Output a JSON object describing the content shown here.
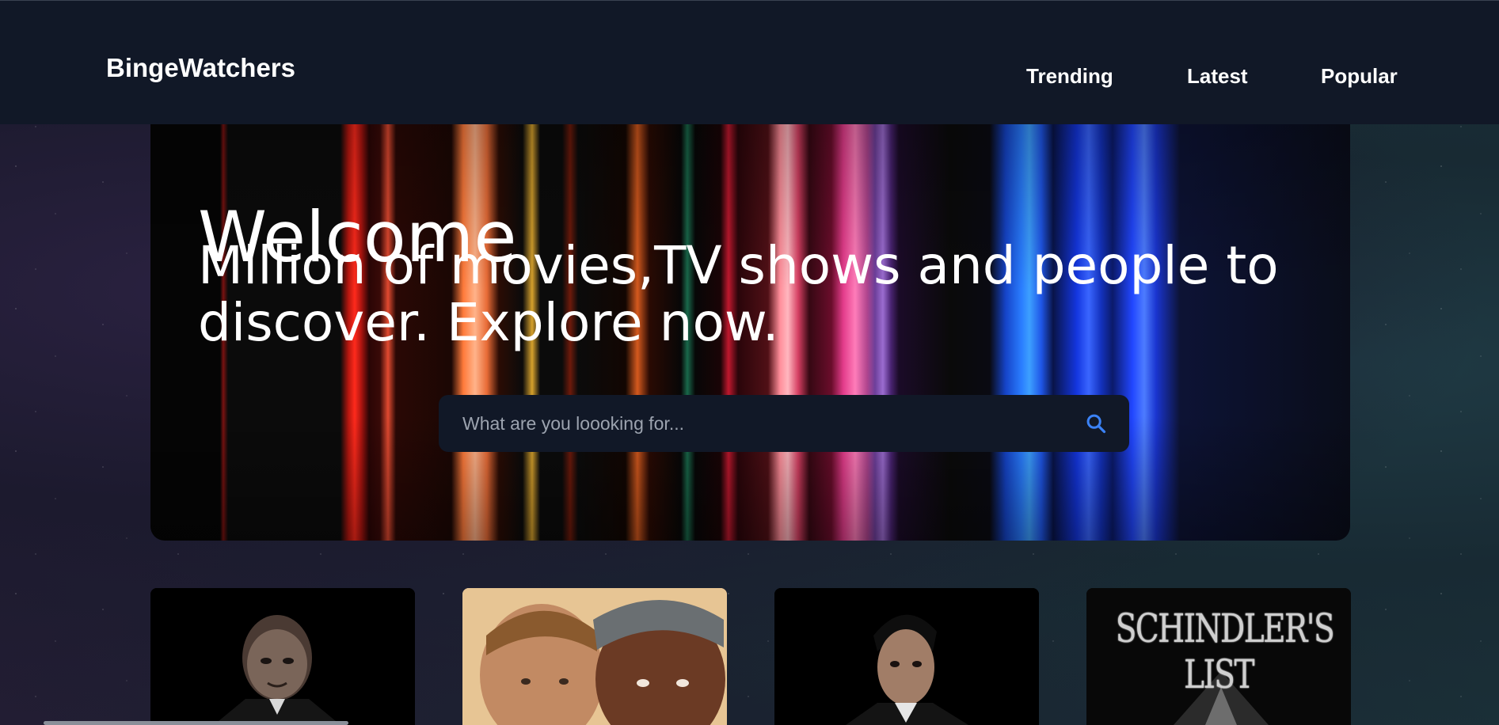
{
  "app": {
    "brand": "BingeWatchers"
  },
  "nav": {
    "items": [
      {
        "label": "Trending"
      },
      {
        "label": "Latest"
      },
      {
        "label": "Popular"
      }
    ]
  },
  "hero": {
    "title": "Welcome",
    "subtitle": "Million of movies,TV shows and people to discover. Explore now."
  },
  "search": {
    "placeholder": "What are you loooking for...",
    "value": "",
    "icon": "search-icon",
    "icon_color": "#3b82f6"
  },
  "movies": [
    {
      "poster_text": ""
    },
    {
      "poster_text": ""
    },
    {
      "poster_text": ""
    },
    {
      "poster_text": "SCHINDLER'S LIST"
    }
  ],
  "colors": {
    "navbar_bg": "#111827",
    "search_bg": "#111827",
    "accent": "#3b82f6"
  }
}
